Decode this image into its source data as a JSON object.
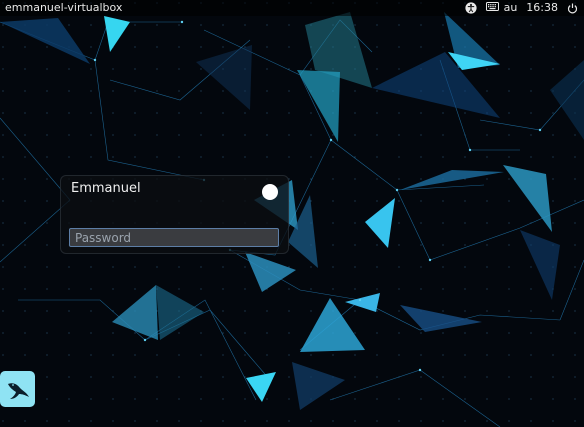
{
  "topbar": {
    "hostname": "emmanuel-virtualbox",
    "layout": "au",
    "time": "16:38",
    "icons": [
      "accessibility-icon",
      "keyboard-icon",
      "power-icon"
    ]
  },
  "login": {
    "username": "Emmanuel",
    "password_placeholder": "Password"
  },
  "launcher": {
    "icon": "bird-icon"
  },
  "colors": {
    "background": "#040810",
    "accent": "#2fb6e6",
    "launcher_bg": "#8fe3f3"
  }
}
